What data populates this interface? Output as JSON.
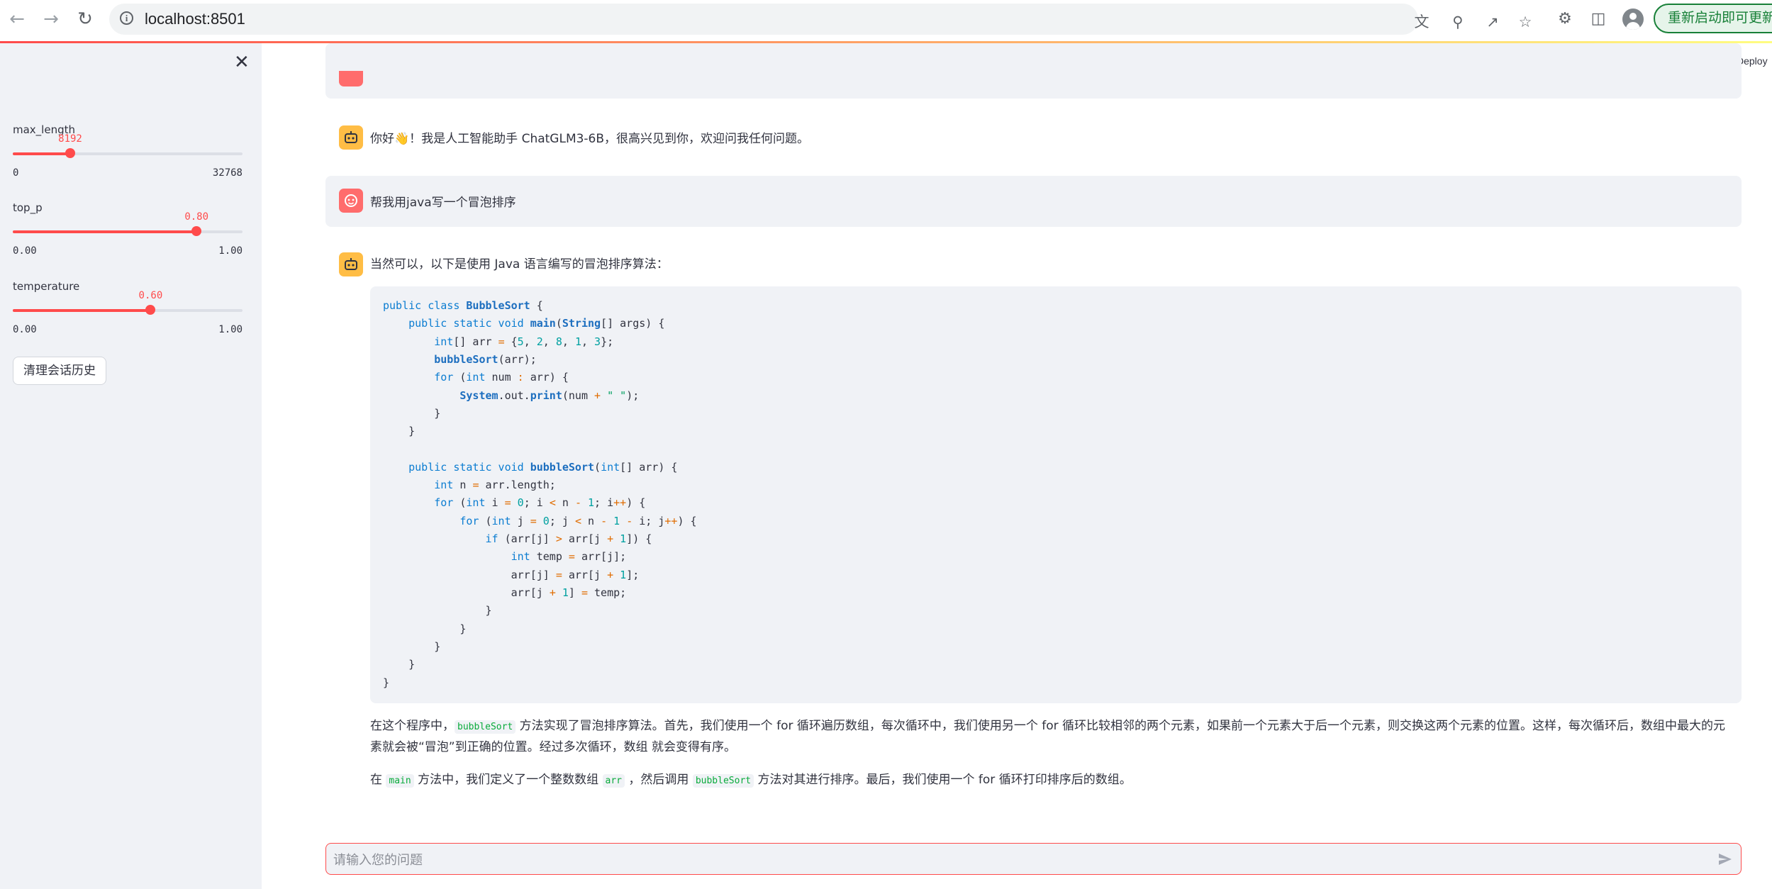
{
  "browser": {
    "url": "localhost:8501",
    "update_button": "重新启动即可更新"
  },
  "sidebar": {
    "sliders": [
      {
        "label": "max_length",
        "value": "8192",
        "min": "0",
        "max": "32768",
        "fraction": 0.25
      },
      {
        "label": "top_p",
        "value": "0.80",
        "min": "0.00",
        "max": "1.00",
        "fraction": 0.8
      },
      {
        "label": "temperature",
        "value": "0.60",
        "min": "0.00",
        "max": "1.00",
        "fraction": 0.6
      }
    ],
    "clear_button": "清理会话历史"
  },
  "header": {
    "deploy": "Deploy"
  },
  "chat": {
    "assistant_greeting": "你好👋！我是人工智能助手 ChatGLM3-6B，很高兴见到你，欢迎问我任何问题。",
    "user_message": "帮我用java写一个冒泡排序",
    "assistant_intro": "当然可以，以下是使用 Java 语言编写的冒泡排序算法：",
    "explanation_p1_before": "在这个程序中，",
    "explanation_p1_code": "bubbleSort",
    "explanation_p1_after": " 方法实现了冒泡排序算法。首先，我们使用一个 for 循环遍历数组，每次循环中，我们使用另一个 for 循环比较相邻的两个元素，如果前一个元素大于后一个元素，则交换这两个元素的位置。这样，每次循环后，数组中最大的元素就会被“冒泡”到正确的位置。经过多次循环，数组 就会变得有序。",
    "explanation_p2_a": "在 ",
    "explanation_p2_code1": "main",
    "explanation_p2_b": " 方法中，我们定义了一个整数数组 ",
    "explanation_p2_code2": "arr",
    "explanation_p2_c": " ，然后调用 ",
    "explanation_p2_code3": "bubbleSort",
    "explanation_p2_d": " 方法对其进行排序。最后，我们使用一个 for 循环打印排序后的数组。"
  },
  "code_lines": [
    "public class BubbleSort {",
    "    public static void main(String[] args) {",
    "        int[] arr = {5, 2, 8, 1, 3};",
    "        bubbleSort(arr);",
    "        for (int num : arr) {",
    "            System.out.print(num + \" \");",
    "        }",
    "    }",
    "",
    "    public static void bubbleSort(int[] arr) {",
    "        int n = arr.length;",
    "        for (int i = 0; i < n - 1; i++) {",
    "            for (int j = 0; j < n - 1 - i; j++) {",
    "                if (arr[j] > arr[j + 1]) {",
    "                    int temp = arr[j];",
    "                    arr[j] = arr[j + 1];",
    "                    arr[j + 1] = temp;",
    "                }",
    "            }",
    "        }",
    "    }",
    "}"
  ],
  "input": {
    "placeholder": "请输入您的问题"
  },
  "colors": {
    "accent": "#ff4b4b",
    "sidebar_bg": "#f0f2f6",
    "assistant_avatar": "#ffbd45",
    "user_avatar": "#ff6c6c"
  }
}
